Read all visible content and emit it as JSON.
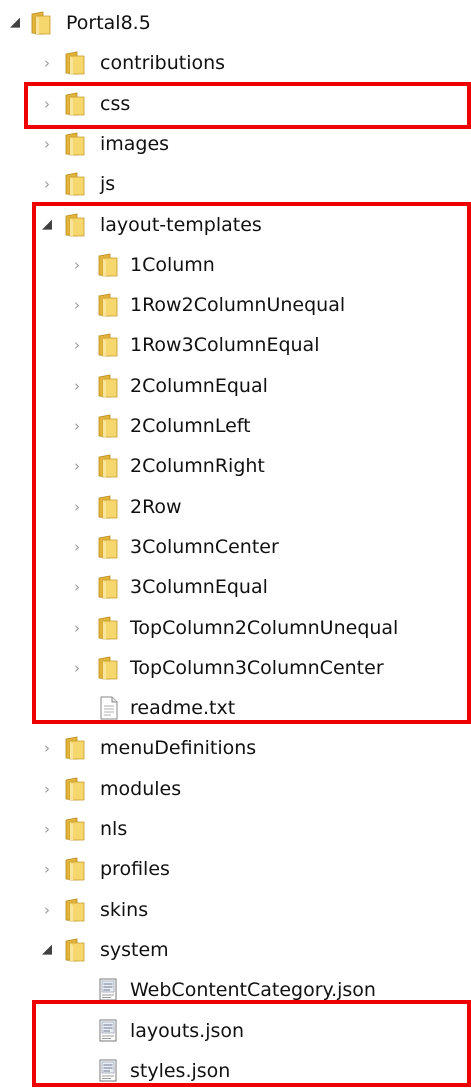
{
  "tree": {
    "nodes": [
      {
        "label": "Portal8.5",
        "depth": 0,
        "type": "folder",
        "expander": "open",
        "icon": "folder-icon"
      },
      {
        "label": "contributions",
        "depth": 1,
        "type": "folder",
        "expander": "closed",
        "icon": "folder-icon"
      },
      {
        "label": "css",
        "depth": 1,
        "type": "folder",
        "expander": "closed",
        "icon": "folder-icon"
      },
      {
        "label": "images",
        "depth": 1,
        "type": "folder",
        "expander": "closed",
        "icon": "folder-icon"
      },
      {
        "label": "js",
        "depth": 1,
        "type": "folder",
        "expander": "closed",
        "icon": "folder-icon"
      },
      {
        "label": "layout-templates",
        "depth": 1,
        "type": "folder",
        "expander": "open",
        "icon": "folder-icon"
      },
      {
        "label": "1Column",
        "depth": 2,
        "type": "folder",
        "expander": "closed",
        "icon": "folder-icon"
      },
      {
        "label": "1Row2ColumnUnequal",
        "depth": 2,
        "type": "folder",
        "expander": "closed",
        "icon": "folder-icon"
      },
      {
        "label": "1Row3ColumnEqual",
        "depth": 2,
        "type": "folder",
        "expander": "closed",
        "icon": "folder-icon"
      },
      {
        "label": "2ColumnEqual",
        "depth": 2,
        "type": "folder",
        "expander": "closed",
        "icon": "folder-icon"
      },
      {
        "label": "2ColumnLeft",
        "depth": 2,
        "type": "folder",
        "expander": "closed",
        "icon": "folder-icon"
      },
      {
        "label": "2ColumnRight",
        "depth": 2,
        "type": "folder",
        "expander": "closed",
        "icon": "folder-icon"
      },
      {
        "label": "2Row",
        "depth": 2,
        "type": "folder",
        "expander": "closed",
        "icon": "folder-icon"
      },
      {
        "label": "3ColumnCenter",
        "depth": 2,
        "type": "folder",
        "expander": "closed",
        "icon": "folder-icon"
      },
      {
        "label": "3ColumnEqual",
        "depth": 2,
        "type": "folder",
        "expander": "closed",
        "icon": "folder-icon"
      },
      {
        "label": "TopColumn2ColumnUnequal",
        "depth": 2,
        "type": "folder",
        "expander": "closed",
        "icon": "folder-icon"
      },
      {
        "label": "TopColumn3ColumnCenter",
        "depth": 2,
        "type": "folder",
        "expander": "closed",
        "icon": "folder-icon"
      },
      {
        "label": "readme.txt",
        "depth": 2,
        "type": "text-file",
        "expander": "none",
        "icon": "text-file-icon"
      },
      {
        "label": "menuDefinitions",
        "depth": 1,
        "type": "folder",
        "expander": "closed",
        "icon": "folder-icon"
      },
      {
        "label": "modules",
        "depth": 1,
        "type": "folder",
        "expander": "closed",
        "icon": "folder-icon"
      },
      {
        "label": "nls",
        "depth": 1,
        "type": "folder",
        "expander": "closed",
        "icon": "folder-icon"
      },
      {
        "label": "profiles",
        "depth": 1,
        "type": "folder",
        "expander": "closed",
        "icon": "folder-icon"
      },
      {
        "label": "skins",
        "depth": 1,
        "type": "folder",
        "expander": "closed",
        "icon": "folder-icon"
      },
      {
        "label": "system",
        "depth": 1,
        "type": "folder",
        "expander": "open",
        "icon": "folder-icon"
      },
      {
        "label": "WebContentCategory.json",
        "depth": 2,
        "type": "json-file",
        "expander": "none",
        "icon": "json-file-icon"
      },
      {
        "label": "layouts.json",
        "depth": 2,
        "type": "json-file",
        "expander": "none",
        "icon": "json-file-icon"
      },
      {
        "label": "styles.json",
        "depth": 2,
        "type": "json-file",
        "expander": "none",
        "icon": "json-file-icon"
      }
    ],
    "highlighted_items": [
      "css",
      "layout-templates",
      "layouts.json",
      "styles.json"
    ]
  },
  "colors": {
    "highlight": "#ee0000",
    "folder_front": "#f5d76e",
    "folder_back": "#e2b53a",
    "text": "#111111"
  }
}
